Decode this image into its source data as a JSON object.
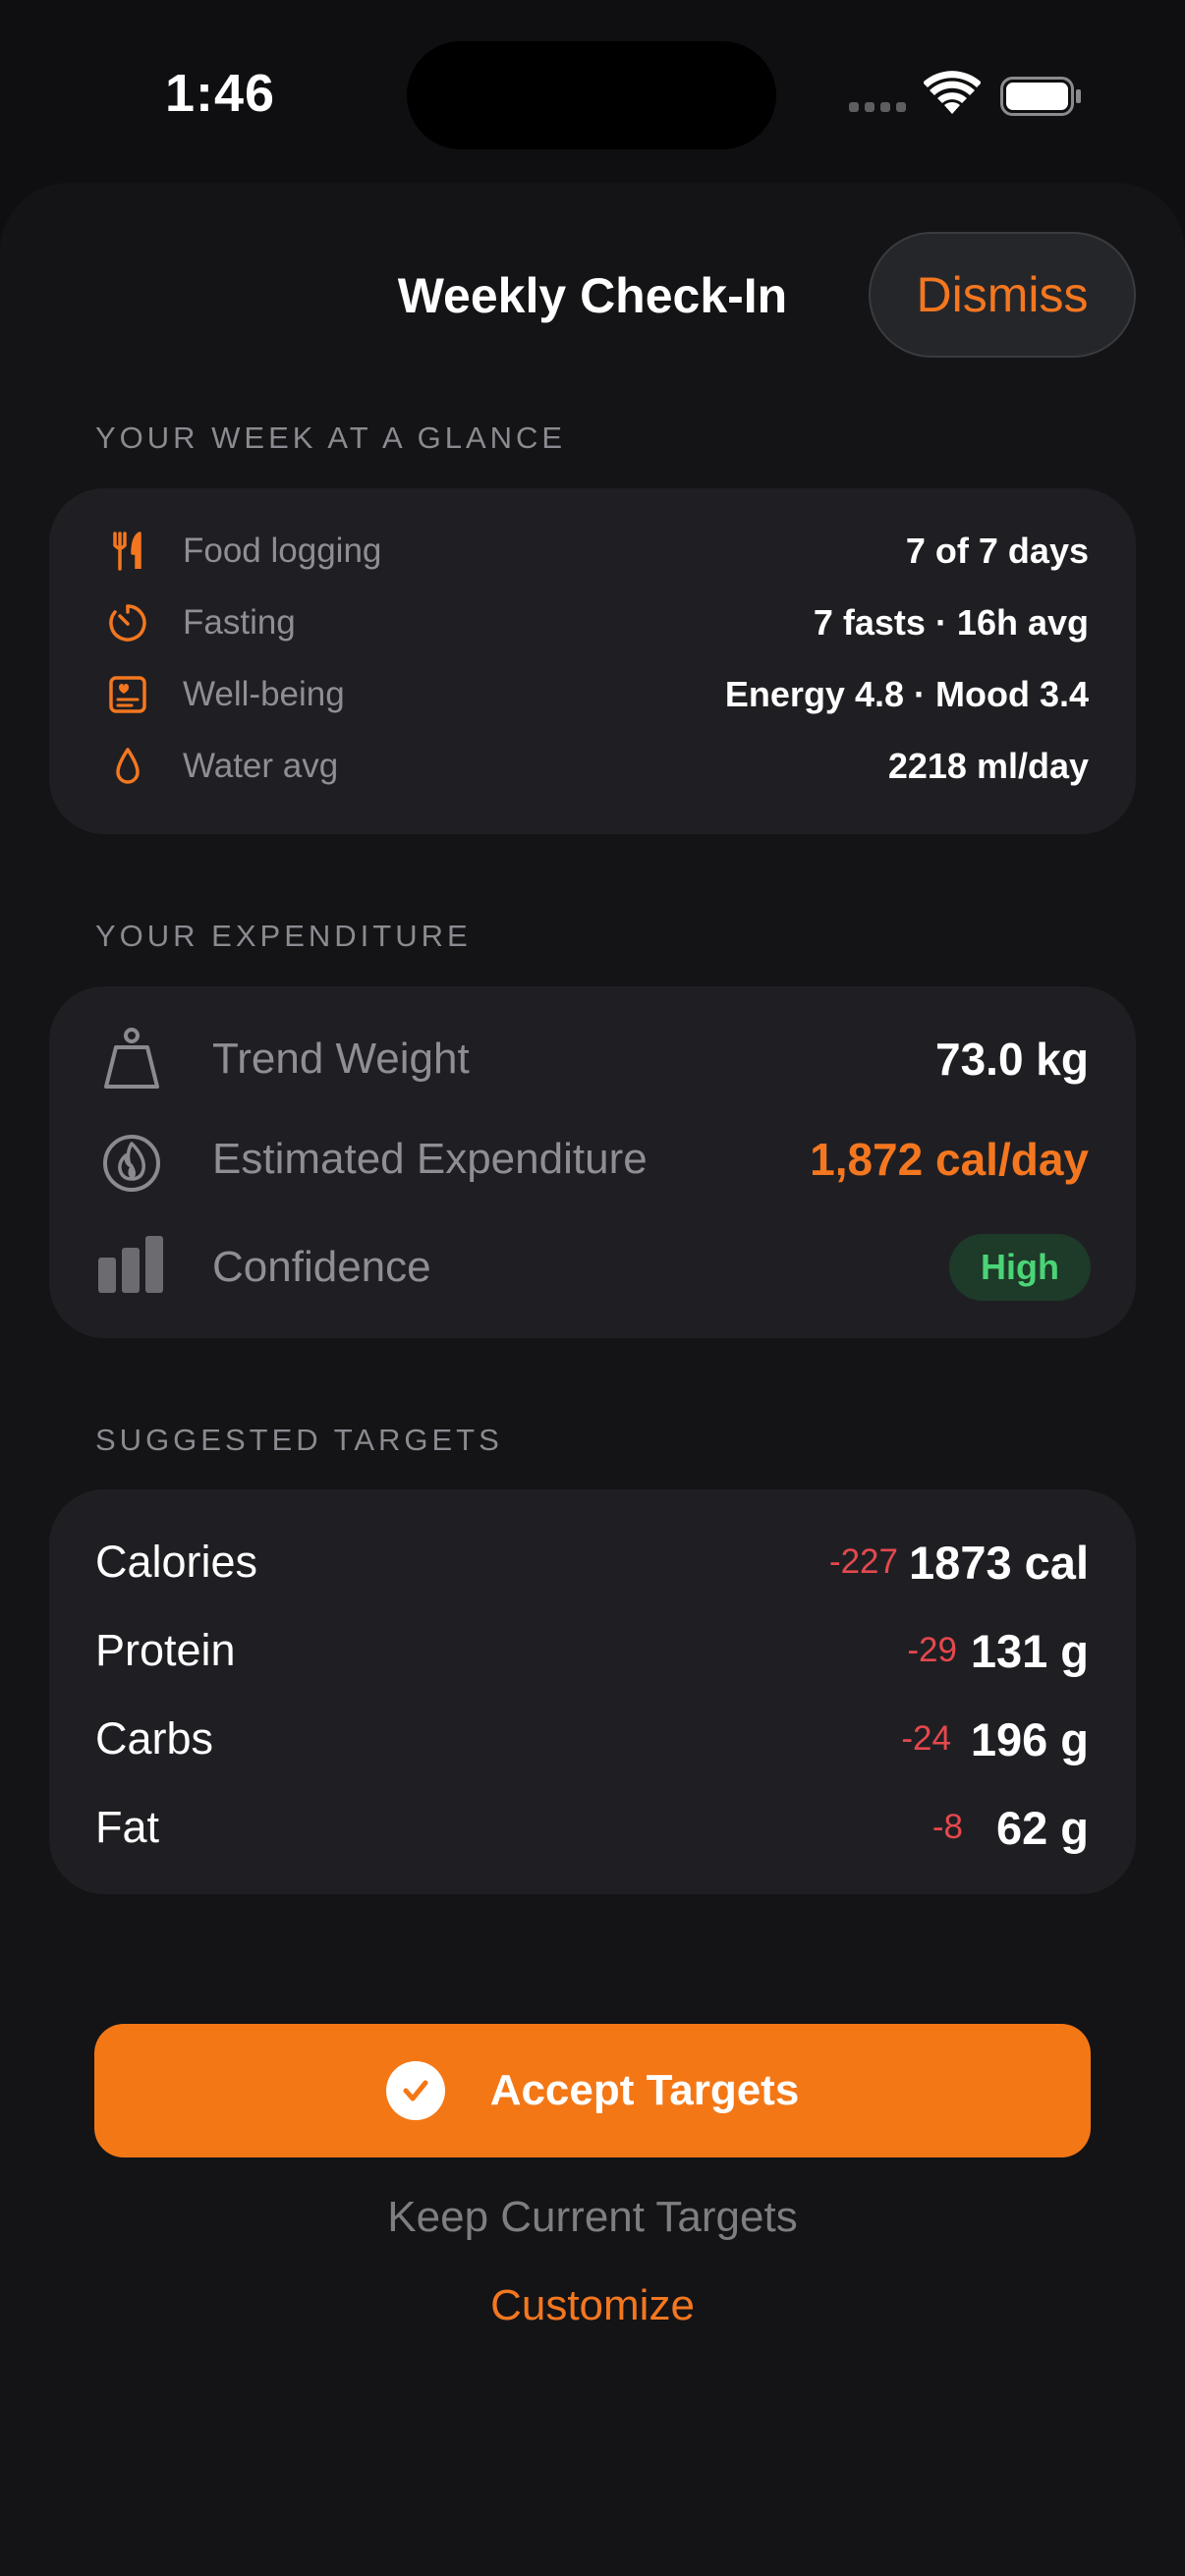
{
  "status_bar": {
    "time": "1:46"
  },
  "header": {
    "title": "Weekly Check-In",
    "dismiss_label": "Dismiss"
  },
  "glance": {
    "section_title": "YOUR WEEK AT A GLANCE",
    "rows": [
      {
        "icon": "fork-knife-icon",
        "label": "Food logging",
        "value": "7 of 7 days"
      },
      {
        "icon": "timer-icon",
        "label": "Fasting",
        "value": "7 fasts · 16h avg"
      },
      {
        "icon": "heart-card-icon",
        "label": "Well-being",
        "value": "Energy 4.8 · Mood 3.4"
      },
      {
        "icon": "water-drop-icon",
        "label": "Water avg",
        "value": "2218 ml/day"
      }
    ]
  },
  "expenditure": {
    "section_title": "YOUR EXPENDITURE",
    "trend_weight": {
      "icon": "scale-weight-icon",
      "label": "Trend Weight",
      "value": "73.0 kg"
    },
    "estimated": {
      "icon": "flame-icon",
      "label": "Estimated Expenditure",
      "value": "1,872 cal/day"
    },
    "confidence": {
      "icon": "bars-icon",
      "label": "Confidence",
      "badge": "High"
    }
  },
  "targets": {
    "section_title": "SUGGESTED TARGETS",
    "rows": [
      {
        "label": "Calories",
        "delta": "-227",
        "value": "1873 cal"
      },
      {
        "label": "Protein",
        "delta": "-29",
        "value": "131 g"
      },
      {
        "label": "Carbs",
        "delta": "-24",
        "value": "196 g"
      },
      {
        "label": "Fat",
        "delta": "-8",
        "value": "62 g"
      }
    ]
  },
  "actions": {
    "accept_label": "Accept Targets",
    "keep_label": "Keep Current Targets",
    "customize_label": "Customize"
  },
  "colors": {
    "accent": "#f47716",
    "negative": "#e5484d",
    "positive": "#4bd476",
    "card": "#1f1f23",
    "background": "#0f0f12"
  }
}
